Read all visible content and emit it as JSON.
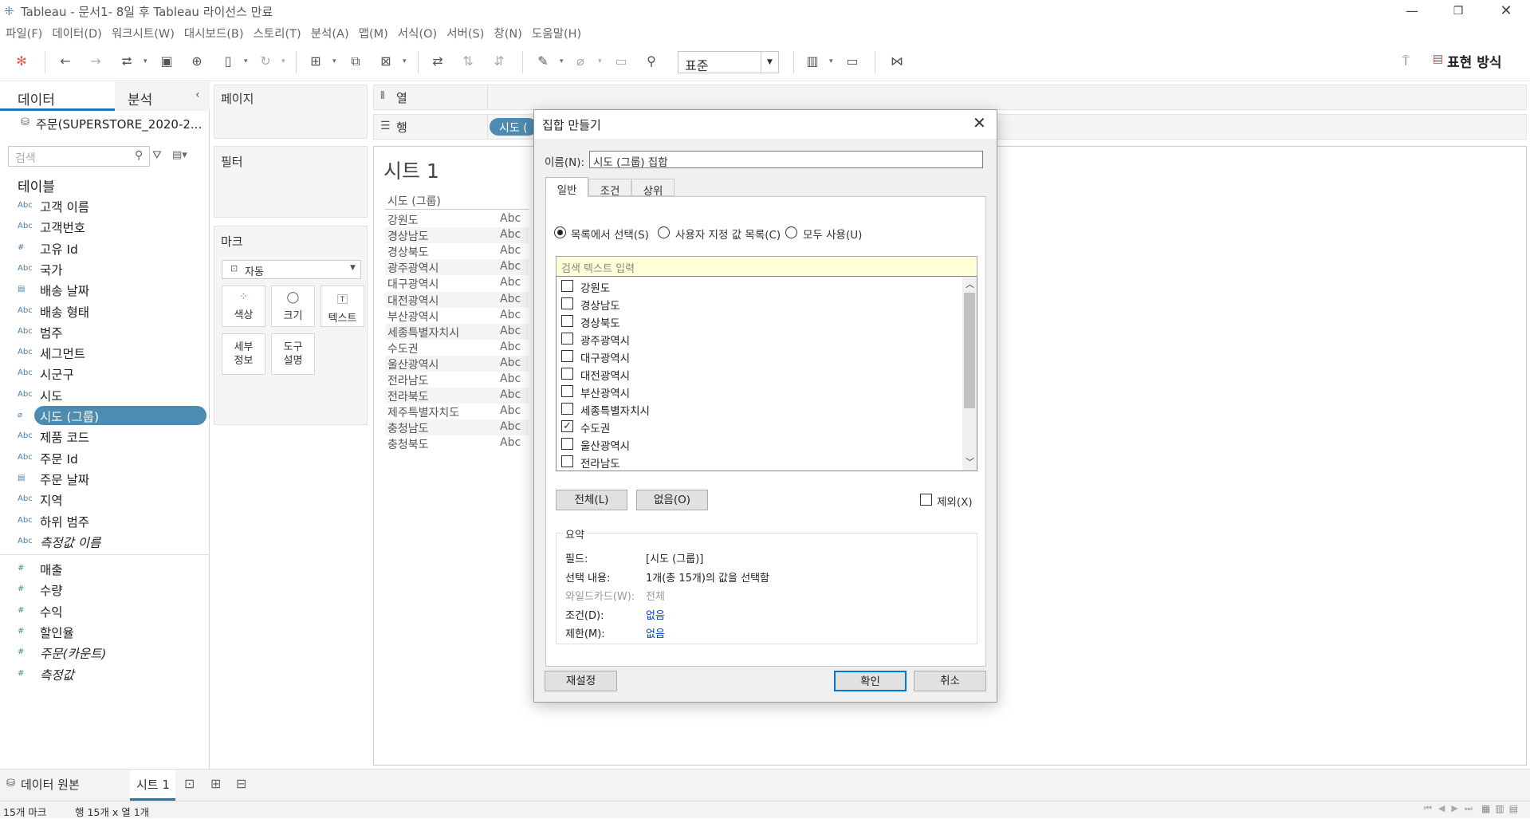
{
  "window": {
    "title": "Tableau - 문서1- 8일 후 Tableau 라이선스 만료"
  },
  "menu": [
    "파일(F)",
    "데이터(D)",
    "워크시트(W)",
    "대시보드(B)",
    "스토리(T)",
    "분석(A)",
    "맵(M)",
    "서식(O)",
    "서버(S)",
    "창(N)",
    "도움말(H)"
  ],
  "toolbar": {
    "zoom_value": "표준",
    "show_me_label": "표현 방식"
  },
  "left_panel": {
    "tab_data": "데이터",
    "tab_analysis": "분석",
    "datasource": "주문(SUPERSTORE_2020-2...",
    "search_placeholder": "검색",
    "tables_heading": "테이블",
    "dimensions": [
      {
        "icon": "Abc",
        "name": "고객 이름"
      },
      {
        "icon": "Abc",
        "name": "고객번호"
      },
      {
        "icon": "#",
        "name": "고유 Id"
      },
      {
        "icon": "Abc",
        "name": "국가"
      },
      {
        "icon": "date",
        "name": "배송 날짜"
      },
      {
        "icon": "Abc",
        "name": "배송 형태"
      },
      {
        "icon": "Abc",
        "name": "범주"
      },
      {
        "icon": "Abc",
        "name": "세그먼트"
      },
      {
        "icon": "Abc",
        "name": "시군구"
      },
      {
        "icon": "Abc",
        "name": "시도"
      },
      {
        "icon": "clip",
        "name": "시도 (그룹)"
      },
      {
        "icon": "Abc",
        "name": "제품 코드"
      },
      {
        "icon": "Abc",
        "name": "주문 Id"
      },
      {
        "icon": "date",
        "name": "주문 날짜"
      },
      {
        "icon": "Abc",
        "name": "지역"
      },
      {
        "icon": "Abc",
        "name": "하위 범주"
      },
      {
        "icon": "Abc",
        "name": "측정값 이름"
      }
    ],
    "measures": [
      {
        "icon": "#",
        "name": "매출"
      },
      {
        "icon": "#",
        "name": "수량"
      },
      {
        "icon": "#",
        "name": "수익"
      },
      {
        "icon": "#",
        "name": "할인율"
      },
      {
        "icon": "#",
        "name": "주문(카운트)"
      },
      {
        "icon": "#",
        "name": "측정값"
      }
    ]
  },
  "cards": {
    "pages": "페이지",
    "filters": "필터",
    "marks": "마크",
    "marks_type": "자동",
    "mark_buttons": [
      "색상",
      "크기",
      "텍스트",
      "세부\n정보",
      "도구\n설명"
    ],
    "columns": "열",
    "rows": "행",
    "rows_pill": "시도 ("
  },
  "sheet": {
    "title": "시트 1",
    "column_header": "시도 (그룹)",
    "rows": [
      "강원도",
      "경상남도",
      "경상북도",
      "광주광역시",
      "대구광역시",
      "대전광역시",
      "부산광역시",
      "세종특별자치시",
      "수도권",
      "울산광역시",
      "전라남도",
      "전라북도",
      "제주특별자치도",
      "충청남도",
      "충청북도"
    ],
    "cell_value": "Abc"
  },
  "dialog": {
    "title": "집합 만들기",
    "name_label": "이름(N):",
    "name_value": "시도 (그룹) 집합",
    "tabs": [
      "일반",
      "조건",
      "상위"
    ],
    "radio_options": [
      "목록에서 선택(S)",
      "사용자 지정 값 목록(C)",
      "모두 사용(U)"
    ],
    "search_placeholder": "검색 텍스트 입력",
    "items": [
      {
        "label": "강원도",
        "checked": false
      },
      {
        "label": "경상남도",
        "checked": false
      },
      {
        "label": "경상북도",
        "checked": false
      },
      {
        "label": "광주광역시",
        "checked": false
      },
      {
        "label": "대구광역시",
        "checked": false
      },
      {
        "label": "대전광역시",
        "checked": false
      },
      {
        "label": "부산광역시",
        "checked": false
      },
      {
        "label": "세종특별자치시",
        "checked": false
      },
      {
        "label": "수도권",
        "checked": true
      },
      {
        "label": "울산광역시",
        "checked": false
      },
      {
        "label": "전라남도",
        "checked": false
      }
    ],
    "all_button": "전체(L)",
    "none_button": "없음(O)",
    "exclude_label": "제외(X)",
    "summary_heading": "요약",
    "summary": [
      {
        "key": "필드:",
        "value": "[시도 (그룹)]"
      },
      {
        "key": "선택 내용:",
        "value": "1개(총 15개)의 값을 선택함"
      },
      {
        "key": "와일드카드(W):",
        "value": "전체"
      },
      {
        "key": "조건(D):",
        "value": "없음"
      },
      {
        "key": "제한(M):",
        "value": "없음"
      }
    ],
    "reset_button": "재설정",
    "ok_button": "확인",
    "cancel_button": "취소"
  },
  "bottom_tabs": {
    "datasource": "데이터 원본",
    "sheet": "시트 1"
  },
  "status": {
    "marks": "15개 마크",
    "dims": "행 15개 x 열 1개"
  }
}
